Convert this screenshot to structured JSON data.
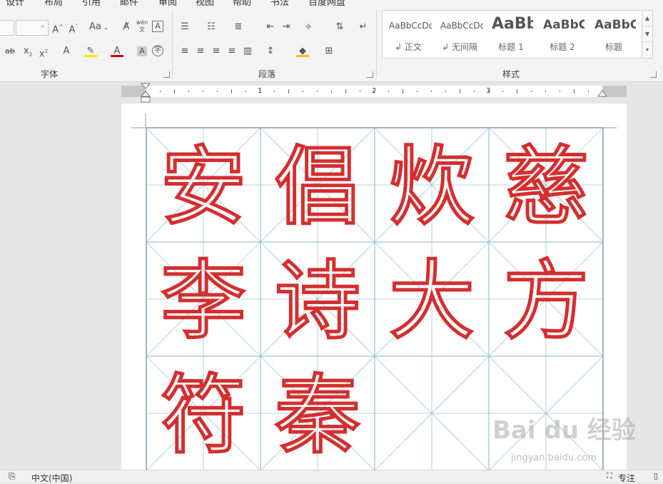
{
  "menu": {
    "items": [
      "设计",
      "布局",
      "引用",
      "邮件",
      "审阅",
      "视图",
      "帮助",
      "书法",
      "百度网盘"
    ]
  },
  "ribbon": {
    "font_group": {
      "label": "字体",
      "case_button": "Aa",
      "phonetic_label": "wén\n文"
    },
    "paragraph_group": {
      "label": "段落"
    },
    "styles_group": {
      "label": "样式",
      "items": [
        {
          "sample": "AaBbCcDd",
          "name": "↲ 正文"
        },
        {
          "sample": "AaBbCcDd",
          "name": "↲ 无间隔"
        },
        {
          "sample": "AaBb",
          "name": "标题 1"
        },
        {
          "sample": "AaBbC",
          "name": "标题 2"
        },
        {
          "sample": "AaBbC",
          "name": "标题"
        }
      ]
    }
  },
  "ruler": {
    "labels": [
      "1",
      "2",
      "3"
    ]
  },
  "document": {
    "grid": {
      "columns": 8,
      "rows": 6,
      "line_color": "#9fc3dc",
      "ink_color": "#d32f2f"
    },
    "characters": [
      "安",
      "倡",
      "炊",
      "慈",
      "李",
      "诗",
      "大",
      "方",
      "符",
      "秦"
    ]
  },
  "status": {
    "language": "中文(中国)",
    "focus": "专注"
  },
  "watermark": {
    "brand": "Bai du 经验",
    "url": "jingyan.baidu.com"
  }
}
